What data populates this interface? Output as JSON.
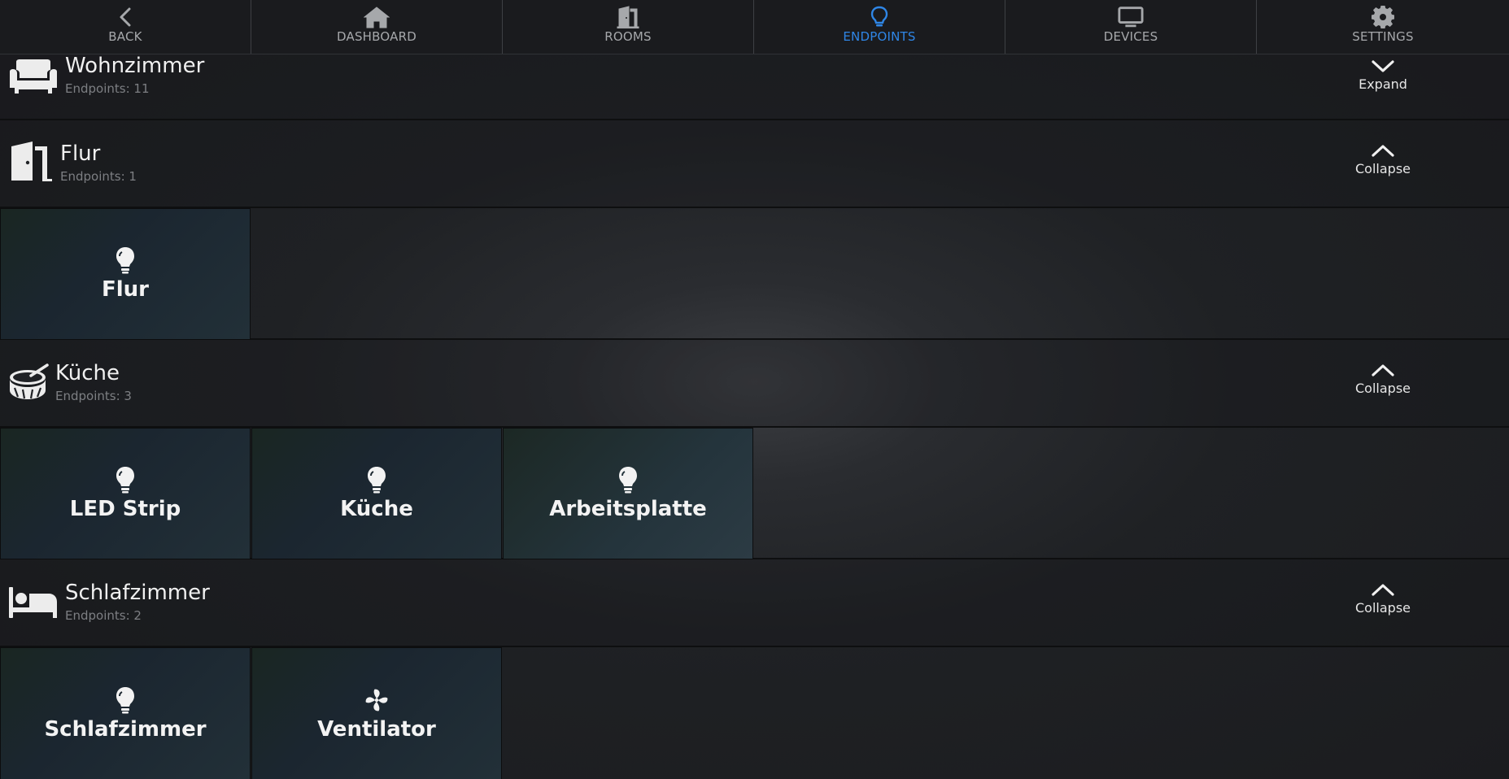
{
  "nav": {
    "items": [
      {
        "label": "BACK",
        "icon": "chevron-left-icon",
        "active": false
      },
      {
        "label": "DASHBOARD",
        "icon": "home-icon",
        "active": false
      },
      {
        "label": "ROOMS",
        "icon": "door-icon",
        "active": false
      },
      {
        "label": "ENDPOINTS",
        "icon": "lightbulb-icon",
        "active": true
      },
      {
        "label": "DEVICES",
        "icon": "monitor-icon",
        "active": false
      },
      {
        "label": "SETTINGS",
        "icon": "gear-icon",
        "active": false
      }
    ],
    "active_color": "#2f86e6"
  },
  "rooms": [
    {
      "name": "Wohnzimmer",
      "subtitle": "Endpoints: 11",
      "icon": "sofa-icon",
      "toggle": "Expand",
      "expanded": false,
      "endpoints": []
    },
    {
      "name": "Flur",
      "subtitle": "Endpoints: 1",
      "icon": "door-icon",
      "toggle": "Collapse",
      "expanded": true,
      "endpoints": [
        {
          "label": "Flur",
          "icon": "lightbulb-icon"
        }
      ]
    },
    {
      "name": "Küche",
      "subtitle": "Endpoints: 3",
      "icon": "drum-icon",
      "toggle": "Collapse",
      "expanded": true,
      "endpoints": [
        {
          "label": "LED Strip",
          "icon": "lightbulb-icon"
        },
        {
          "label": "Küche",
          "icon": "lightbulb-icon"
        },
        {
          "label": "Arbeitsplatte",
          "icon": "lightbulb-icon"
        }
      ]
    },
    {
      "name": "Schlafzimmer",
      "subtitle": "Endpoints: 2",
      "icon": "bed-icon",
      "toggle": "Collapse",
      "expanded": true,
      "endpoints": [
        {
          "label": "Schlafzimmer",
          "icon": "lightbulb-icon"
        },
        {
          "label": "Ventilator",
          "icon": "fan-icon"
        }
      ]
    }
  ]
}
